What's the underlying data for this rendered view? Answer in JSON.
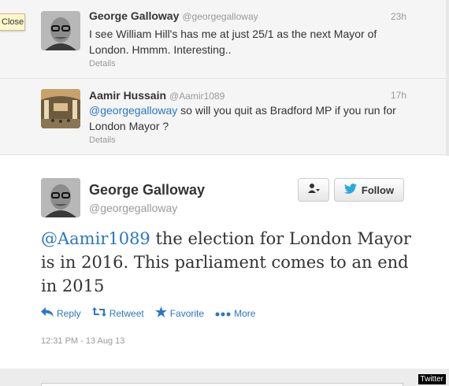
{
  "close_tooltip": "Close",
  "tweets": [
    {
      "name": "George Galloway",
      "handle": "@georgegalloway",
      "time": "23h",
      "text": "I see William Hill's has me at just 25/1 as the next Mayor of London. Hmmm. Interesting..",
      "details": "Details"
    },
    {
      "name": "Aamir Hussain",
      "handle": "@Aamir1089",
      "time": "17h",
      "mention": "@georgegalloway",
      "text": " so will you quit as Bradford MP if you run for London Mayor ?",
      "details": "Details"
    }
  ],
  "permalink": {
    "name": "George Galloway",
    "handle": "@georgegalloway",
    "follow_label": "Follow",
    "mention": "@Aamir1089",
    "text": " the election for London Mayor is in 2016. This parliament comes to an end in 2015",
    "actions": {
      "reply": "Reply",
      "retweet": "Retweet",
      "favorite": "Favorite",
      "more": "More"
    },
    "timestamp": "12:31 PM - 13 Aug 13"
  },
  "credit": "Twitter",
  "colors": {
    "link": "#2a77c3",
    "follow_bird": "#2aa9e0"
  }
}
